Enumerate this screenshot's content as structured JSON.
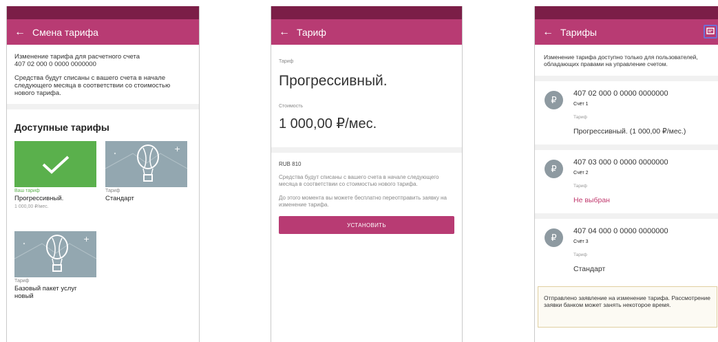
{
  "screen1": {
    "title": "Смена тарифа",
    "info_line1": "Изменение тарифа для расчетного счета",
    "info_account": "407 02 000 0 0000 0000000",
    "info_text": "Средства будут списаны с вашего счета в начале следующего месяца в соответствии со стоимостью нового тарифа.",
    "section_title": "Доступные тарифы",
    "tariffs": [
      {
        "label": "Ваш тариф",
        "name": "Прогрессивный.",
        "price": "1 000,00 ₽/мес."
      },
      {
        "label": "Тариф",
        "name": "Стандарт"
      },
      {
        "label": "Тариф",
        "name": "Базовый пакет услуг новый"
      }
    ],
    "colors": {
      "accent": "#b83b73",
      "statusbar": "#7b1e47",
      "selected": "#5ab04c",
      "tile": "#93a7b0"
    }
  },
  "screen2": {
    "title": "Тариф",
    "tariff_label": "Тариф",
    "tariff_name": "Прогрессивный.",
    "cost_label": "Стоимость",
    "cost_value": "1 000,00 ₽/мес.",
    "currency": "RUB 810",
    "text1": "Средства будут списаны с вашего счета в начале следующего месяца в соответствии со стоимостью нового тарифа.",
    "text2": "До этого момента вы можете бесплатно переотправить заявку на изменение тарифа.",
    "button": "УСТАНОВИТЬ"
  },
  "screen3": {
    "title": "Тарифы",
    "notice": "Изменение тарифа доступно только для пользователей, обладающих правами на управление счетом.",
    "accounts": [
      {
        "avatar": "₽",
        "number": "407 02 000 0 0000 0000000",
        "name": "Счёт 1",
        "tariff_label": "Тариф",
        "tariff": "Прогрессивный. (1 000,00 ₽/мес.)"
      },
      {
        "avatar": "₽",
        "number": "407 03 000 0 0000 0000000",
        "name": "Счёт 2",
        "tariff_label": "Тариф",
        "tariff": "Не выбран"
      },
      {
        "avatar": "₽",
        "number": "407 04 000 0 0000 0000000",
        "name": "Счёт 3",
        "tariff_label": "Тариф",
        "tariff": "Стандарт"
      }
    ],
    "footer": "Отправлено заявление на изменение тарифа. Рассмотрение заявки банком может занять некоторое время."
  }
}
